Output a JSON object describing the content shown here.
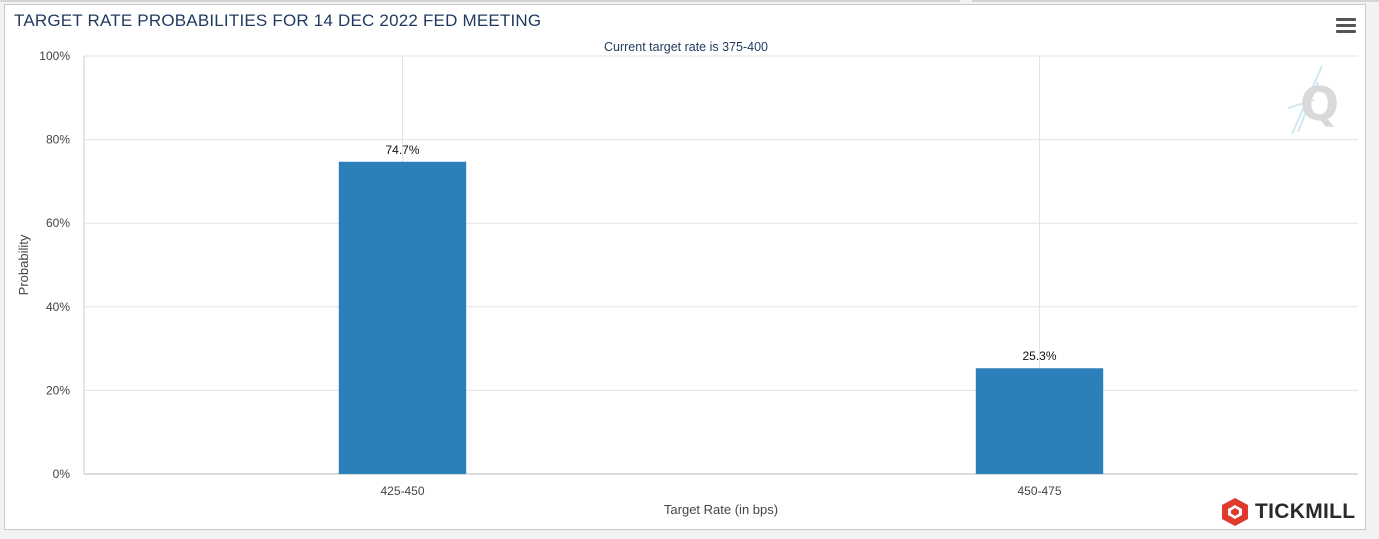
{
  "header": {
    "title": "TARGET RATE PROBABILITIES FOR 14 DEC 2022 FED MEETING",
    "subtitle": "Current target rate is 375-400",
    "menu_icon": "hamburger-menu-icon"
  },
  "branding": {
    "watermark_icon": "q-logo-icon",
    "logo_icon": "tickmill-logo-icon",
    "logo_text": "TICKMILL",
    "logo_color": "#e03a2e"
  },
  "chart_data": {
    "type": "bar",
    "categories": [
      "425-450",
      "450-475"
    ],
    "values": [
      74.7,
      25.3
    ],
    "data_labels": [
      "74.7%",
      "25.3%"
    ],
    "title": "TARGET RATE PROBABILITIES FOR 14 DEC 2022 FED MEETING",
    "subtitle": "Current target rate is 375-400",
    "xlabel": "Target Rate (in bps)",
    "ylabel": "Probability",
    "ylim": [
      0,
      100
    ],
    "yticks": [
      0,
      20,
      40,
      60,
      80,
      100
    ],
    "ytick_labels": [
      "0%",
      "20%",
      "40%",
      "60%",
      "80%",
      "100%"
    ],
    "grid": true,
    "legend": "none",
    "bar_color": "#2b80b9",
    "grid_color": "#e3e3e3"
  }
}
